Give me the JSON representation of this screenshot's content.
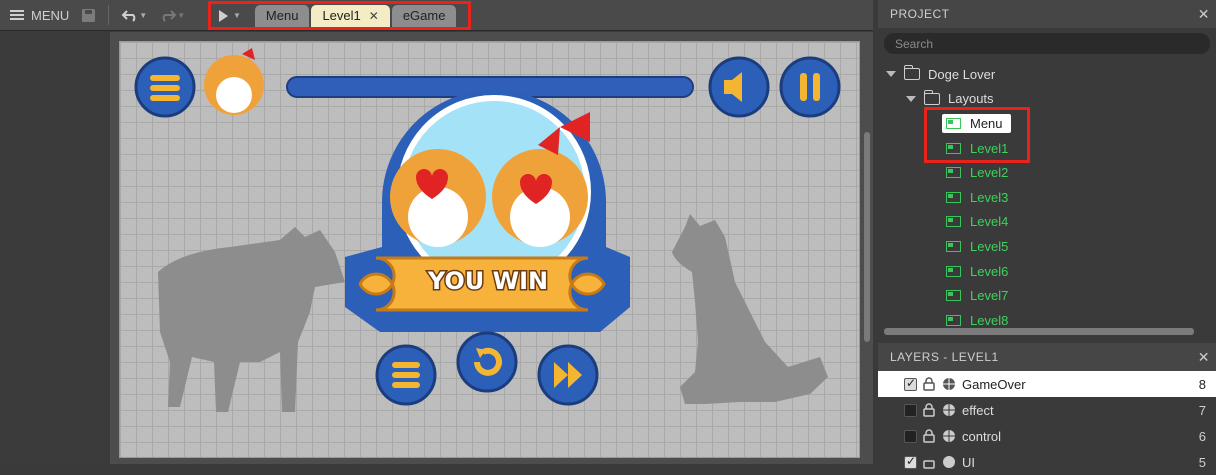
{
  "toolbar": {
    "menu_label": "MENU",
    "tabs": [
      {
        "label": "Menu"
      },
      {
        "label": "Level1",
        "close": "✕"
      },
      {
        "label": "eGame"
      }
    ]
  },
  "game": {
    "banner_text": "YOU WIN"
  },
  "project": {
    "title": "PROJECT",
    "close": "✕",
    "search_placeholder": "Search",
    "root": "Doge Lover",
    "folder": "Layouts",
    "layouts": [
      "Menu",
      "Level1",
      "Level2",
      "Level3",
      "Level4",
      "Level5",
      "Level6",
      "Level7",
      "Level8"
    ]
  },
  "layers": {
    "title": "LAYERS - LEVEL1",
    "close": "✕",
    "items": [
      {
        "name": "GameOver",
        "index": "8",
        "checked": true
      },
      {
        "name": "effect",
        "index": "7",
        "checked": false
      },
      {
        "name": "control",
        "index": "6",
        "checked": false
      },
      {
        "name": "UI",
        "index": "5",
        "checked": true
      }
    ]
  },
  "colors": {
    "highlight": "#e8231b",
    "layout_green": "#3cd35c",
    "tab_active": "#f4ecc4"
  }
}
